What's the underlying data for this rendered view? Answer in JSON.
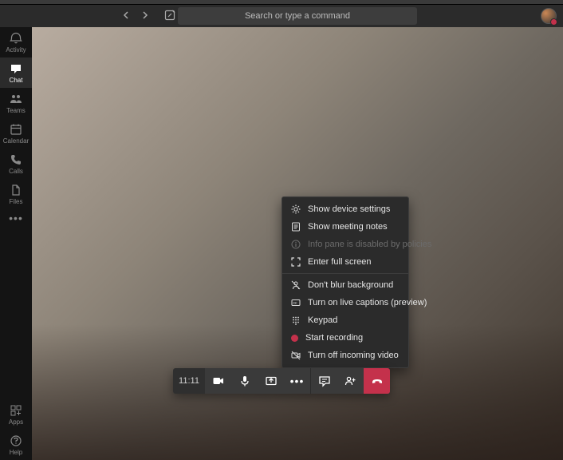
{
  "search": {
    "placeholder": "Search or type a command"
  },
  "rail": {
    "items": [
      {
        "label": "Activity"
      },
      {
        "label": "Chat"
      },
      {
        "label": "Teams"
      },
      {
        "label": "Calendar"
      },
      {
        "label": "Calls"
      },
      {
        "label": "Files"
      }
    ],
    "bottom": [
      {
        "label": "Apps"
      },
      {
        "label": "Help"
      }
    ]
  },
  "context_menu": {
    "group1": [
      {
        "label": "Show device settings"
      },
      {
        "label": "Show meeting notes"
      },
      {
        "label": "Info pane is disabled by policies"
      },
      {
        "label": "Enter full screen"
      }
    ],
    "group2": [
      {
        "label": "Don't blur background"
      },
      {
        "label": "Turn on live captions (preview)"
      },
      {
        "label": "Keypad"
      },
      {
        "label": "Start recording"
      },
      {
        "label": "Turn off incoming video"
      }
    ]
  },
  "callbar": {
    "duration": "11:11"
  },
  "colors": {
    "hangup": "#c4314b",
    "menu_bg": "#2b2b2b"
  }
}
